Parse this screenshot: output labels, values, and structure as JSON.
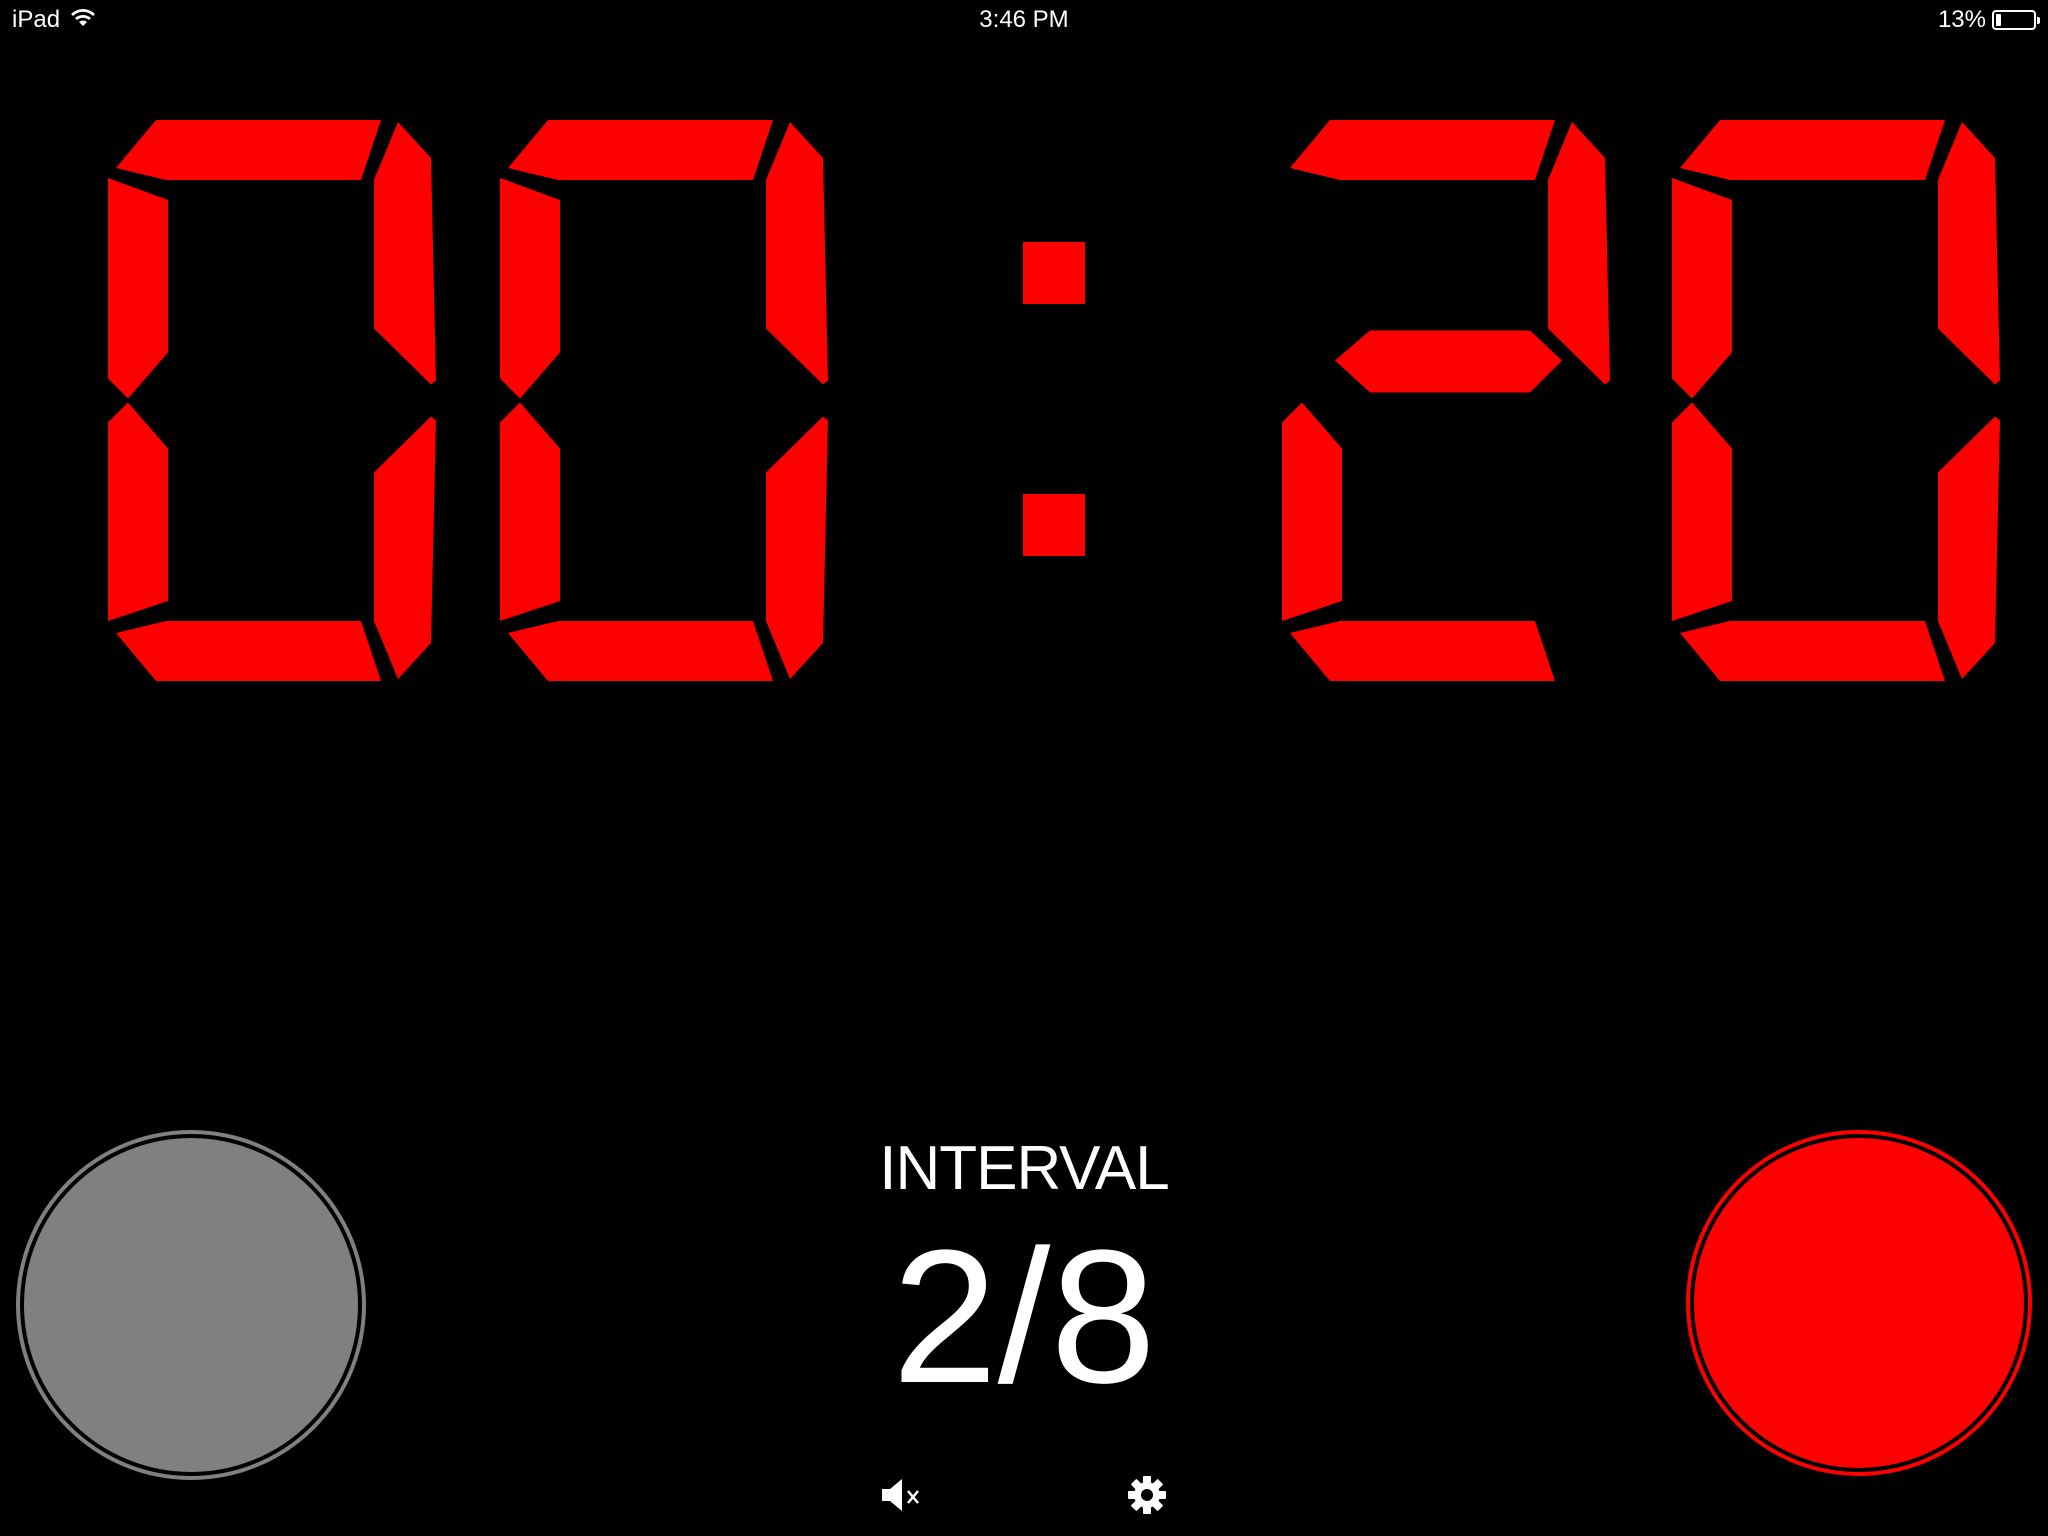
{
  "status_bar": {
    "device": "iPad",
    "time": "3:46 PM",
    "battery_percent": "13%",
    "battery_level": 0.13,
    "icons": [
      "wifi-icon",
      "battery-icon"
    ]
  },
  "timer": {
    "minutes": "00",
    "seconds": "20",
    "display": "00:20",
    "digit_color": "#ff0000"
  },
  "interval": {
    "label": "INTERVAL",
    "count": "2/8"
  },
  "buttons": {
    "reset": {
      "color": "#808080"
    },
    "start": {
      "color": "#ff0000"
    },
    "mute": {
      "icon": "speaker-muted-icon"
    },
    "settings": {
      "icon": "gear-icon"
    }
  }
}
